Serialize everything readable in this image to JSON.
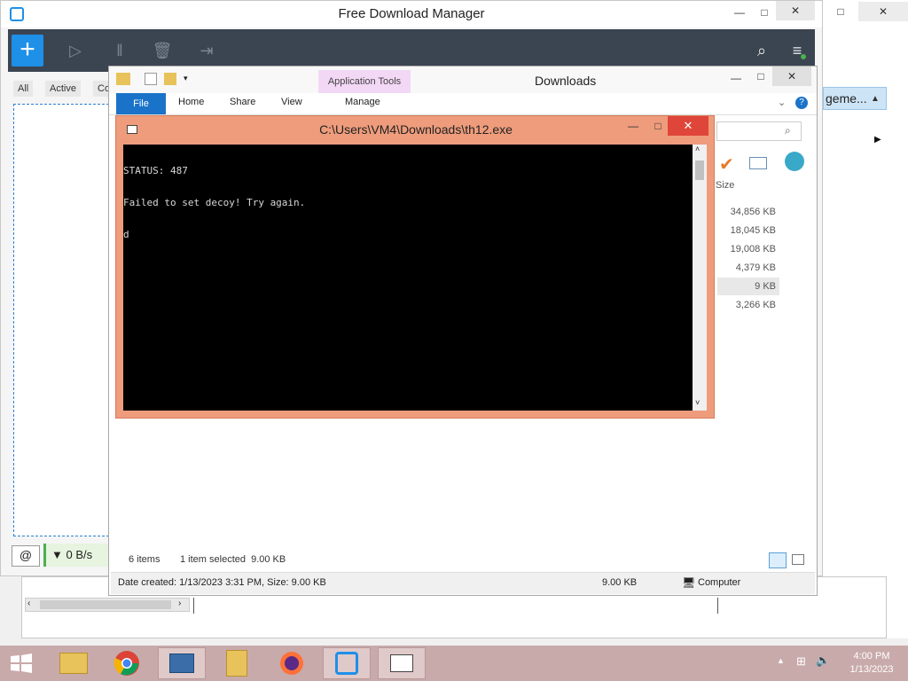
{
  "fdm": {
    "title": "Free Download Manager",
    "tabs": [
      "All",
      "Active",
      "Co"
    ],
    "speed": "▼ 0 B/s",
    "right_partial": "geme..."
  },
  "explorer": {
    "title": "Downloads",
    "app_tools": "Application Tools",
    "ribbon_tabs": {
      "file": "File",
      "home": "Home",
      "share": "Share",
      "view": "View",
      "manage": "Manage"
    },
    "size_header": "Size",
    "sizes": [
      "34,856 KB",
      "18,045 KB",
      "19,008 KB",
      "4,379 KB",
      "9 KB",
      "3,266 KB"
    ],
    "status": {
      "items": "6 items",
      "selected": "1 item selected  9.00 KB"
    },
    "details": {
      "created": "Date created: 1/13/2023 3:31 PM, Size: 9.00 KB",
      "size": "9.00 KB",
      "location": "Computer"
    }
  },
  "console": {
    "title": "C:\\Users\\VM4\\Downloads\\th12.exe",
    "lines": [
      "STATUS: 487",
      "Failed to set decoy! Try again.",
      "d"
    ]
  },
  "taskbar": {
    "time": "4:00 PM",
    "date": "1/13/2023"
  }
}
